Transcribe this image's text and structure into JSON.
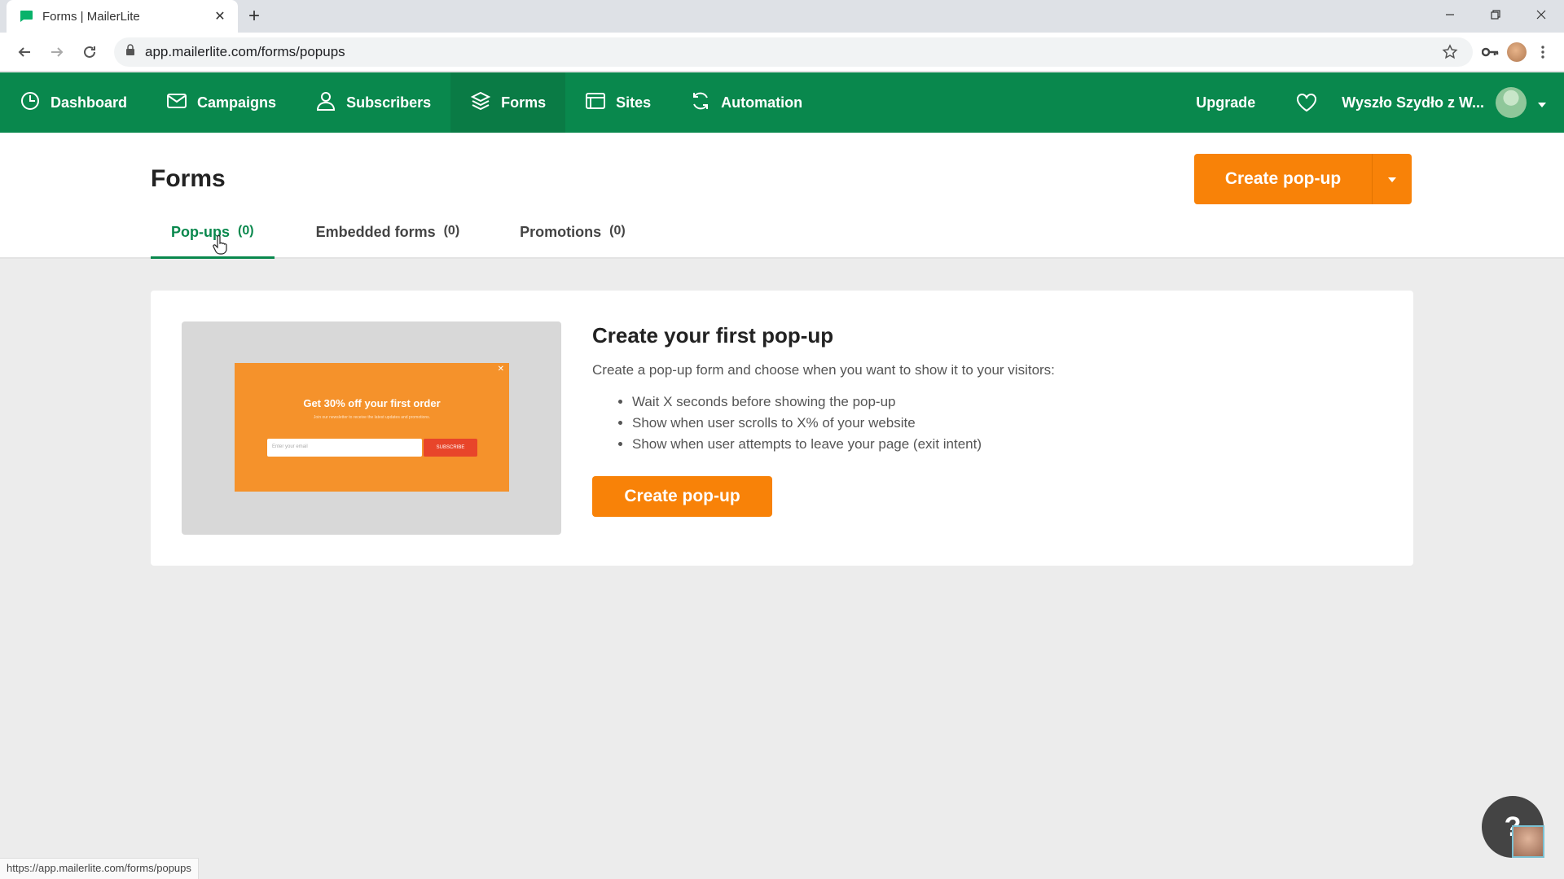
{
  "browser": {
    "tab_title": "Forms | MailerLite",
    "url": "app.mailerlite.com/forms/popups",
    "status_url": "https://app.mailerlite.com/forms/popups"
  },
  "nav": {
    "items": [
      {
        "label": "Dashboard",
        "icon": "dashboard-icon"
      },
      {
        "label": "Campaigns",
        "icon": "envelope-icon"
      },
      {
        "label": "Subscribers",
        "icon": "user-icon"
      },
      {
        "label": "Forms",
        "icon": "layers-icon"
      },
      {
        "label": "Sites",
        "icon": "browser-window-icon"
      },
      {
        "label": "Automation",
        "icon": "refresh-icon"
      }
    ],
    "active": "Forms",
    "upgrade_label": "Upgrade",
    "account_name": "Wyszło Szydło z W..."
  },
  "page": {
    "title": "Forms",
    "create_button": "Create pop-up",
    "tabs": [
      {
        "label": "Pop-ups",
        "count": "(0)"
      },
      {
        "label": "Embedded forms",
        "count": "(0)"
      },
      {
        "label": "Promotions",
        "count": "(0)"
      }
    ]
  },
  "card": {
    "title": "Create your first pop-up",
    "description": "Create a pop-up form and choose when you want to show it to your visitors:",
    "bullets": [
      "Wait X seconds before showing the pop-up",
      "Show when user scrolls to X% of your website",
      "Show when user attempts to leave your page (exit intent)"
    ],
    "button": "Create pop-up",
    "preview": {
      "headline": "Get 30% off your first order",
      "sub": "Join our newsletter to receive the latest updates and promotions.",
      "input_placeholder": "Enter your email",
      "button": "SUBSCRIBE"
    }
  },
  "colors": {
    "brand_green": "#09884d",
    "accent_orange": "#f88208"
  }
}
